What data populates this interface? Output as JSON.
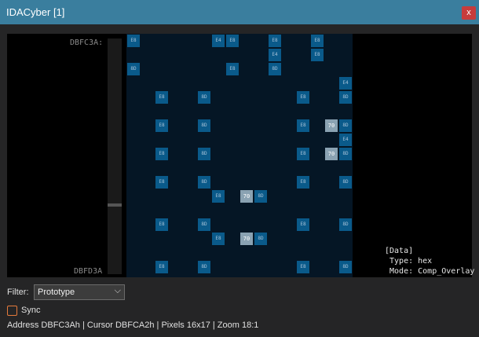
{
  "window": {
    "title": "IDACyber [1]",
    "close_glyph": "x"
  },
  "viewer": {
    "address_top": "DBFC3A:",
    "address_bottom": "DBFD3A",
    "info": "[Data]\n Type: hex\n Mode: Comp_Overlay"
  },
  "cells": [
    {
      "text": "E8",
      "kind": "blue",
      "c": 0,
      "r": 0
    },
    {
      "text": "E4",
      "kind": "blue",
      "c": 6,
      "r": 0
    },
    {
      "text": "E8",
      "kind": "blue",
      "c": 7,
      "r": 0
    },
    {
      "text": "E8",
      "kind": "blue",
      "c": 10,
      "r": 0
    },
    {
      "text": "E8",
      "kind": "blue",
      "c": 13,
      "r": 0
    },
    {
      "text": "E4",
      "kind": "blue",
      "c": 10,
      "r": 1
    },
    {
      "text": "E8",
      "kind": "blue",
      "c": 13,
      "r": 1
    },
    {
      "text": "8D",
      "kind": "blue",
      "c": 0,
      "r": 2
    },
    {
      "text": "E8",
      "kind": "blue",
      "c": 7,
      "r": 2
    },
    {
      "text": "8D",
      "kind": "blue",
      "c": 10,
      "r": 2
    },
    {
      "text": "E4",
      "kind": "blue",
      "c": 15,
      "r": 3
    },
    {
      "text": "E8",
      "kind": "blue",
      "c": 2,
      "r": 4
    },
    {
      "text": "8D",
      "kind": "blue",
      "c": 5,
      "r": 4
    },
    {
      "text": "E8",
      "kind": "blue",
      "c": 12,
      "r": 4
    },
    {
      "text": "8D",
      "kind": "blue",
      "c": 15,
      "r": 4
    },
    {
      "text": "E8",
      "kind": "blue",
      "c": 2,
      "r": 6
    },
    {
      "text": "8D",
      "kind": "blue",
      "c": 5,
      "r": 6
    },
    {
      "text": "E8",
      "kind": "blue",
      "c": 12,
      "r": 6
    },
    {
      "text": "70",
      "kind": "gray",
      "c": 14,
      "r": 6
    },
    {
      "text": "8D",
      "kind": "blue",
      "c": 15,
      "r": 6
    },
    {
      "text": "E4",
      "kind": "blue",
      "c": 15,
      "r": 7
    },
    {
      "text": "E8",
      "kind": "blue",
      "c": 2,
      "r": 8
    },
    {
      "text": "8D",
      "kind": "blue",
      "c": 5,
      "r": 8
    },
    {
      "text": "E8",
      "kind": "blue",
      "c": 12,
      "r": 8
    },
    {
      "text": "70",
      "kind": "gray",
      "c": 14,
      "r": 8
    },
    {
      "text": "8D",
      "kind": "blue",
      "c": 15,
      "r": 8
    },
    {
      "text": "E8",
      "kind": "blue",
      "c": 2,
      "r": 10
    },
    {
      "text": "8D",
      "kind": "blue",
      "c": 5,
      "r": 10
    },
    {
      "text": "E8",
      "kind": "blue",
      "c": 12,
      "r": 10
    },
    {
      "text": "8D",
      "kind": "blue",
      "c": 15,
      "r": 10
    },
    {
      "text": "E8",
      "kind": "blue",
      "c": 6,
      "r": 11
    },
    {
      "text": "70",
      "kind": "gray",
      "c": 8,
      "r": 11
    },
    {
      "text": "8D",
      "kind": "blue",
      "c": 9,
      "r": 11
    },
    {
      "text": "E8",
      "kind": "blue",
      "c": 2,
      "r": 13
    },
    {
      "text": "8D",
      "kind": "blue",
      "c": 5,
      "r": 13
    },
    {
      "text": "E8",
      "kind": "blue",
      "c": 12,
      "r": 13
    },
    {
      "text": "8D",
      "kind": "blue",
      "c": 15,
      "r": 13
    },
    {
      "text": "E8",
      "kind": "blue",
      "c": 6,
      "r": 14
    },
    {
      "text": "70",
      "kind": "gray",
      "c": 8,
      "r": 14
    },
    {
      "text": "8D",
      "kind": "blue",
      "c": 9,
      "r": 14
    },
    {
      "text": "E8",
      "kind": "blue",
      "c": 2,
      "r": 16
    },
    {
      "text": "8D",
      "kind": "blue",
      "c": 5,
      "r": 16
    },
    {
      "text": "E8",
      "kind": "blue",
      "c": 12,
      "r": 16
    },
    {
      "text": "8D",
      "kind": "blue",
      "c": 15,
      "r": 16
    }
  ],
  "filter": {
    "label": "Filter:",
    "selected": "Prototype"
  },
  "sync": {
    "label": "Sync",
    "checked": false
  },
  "status": "Address DBFC3Ah | Cursor DBFCA2h | Pixels 16x17  | Zoom 18:1",
  "colors": {
    "titlebar": "#3a7e9e",
    "close": "#c73c3c",
    "cell_blue": "#0a5a8a",
    "cell_gray": "#8aa2b2",
    "sync_border": "#e57a3c"
  }
}
